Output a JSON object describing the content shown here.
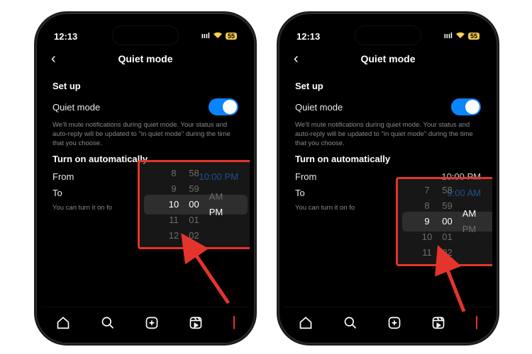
{
  "status": {
    "time": "12:13",
    "battery": "55"
  },
  "nav": {
    "title": "Quiet mode"
  },
  "setup": {
    "heading": "Set up",
    "toggle_label": "Quiet mode",
    "description": "We'll mute notifications during quiet mode. Your status and auto-reply will be updated to \"in quiet mode\" during the time that you choose."
  },
  "auto": {
    "heading": "Turn on automatically",
    "from_label": "From",
    "to_label": "To",
    "hint": "You can turn it on fo"
  },
  "left": {
    "from_value": "10:00 PM",
    "to_value": "",
    "from_active": true,
    "picker": {
      "hours": [
        "8",
        "9",
        "10",
        "11",
        "12"
      ],
      "minutes": [
        "58",
        "59",
        "00",
        "01",
        "02"
      ],
      "period": [
        "",
        "AM",
        "PM",
        "",
        ""
      ]
    }
  },
  "right": {
    "from_value": "10:00 PM",
    "to_value": "9:00 AM",
    "to_active": true,
    "picker": {
      "hours": [
        "7",
        "8",
        "9",
        "10",
        "11"
      ],
      "minutes": [
        "58",
        "59",
        "00",
        "01",
        "02"
      ],
      "period": [
        "",
        "",
        "AM",
        "PM",
        ""
      ]
    }
  }
}
